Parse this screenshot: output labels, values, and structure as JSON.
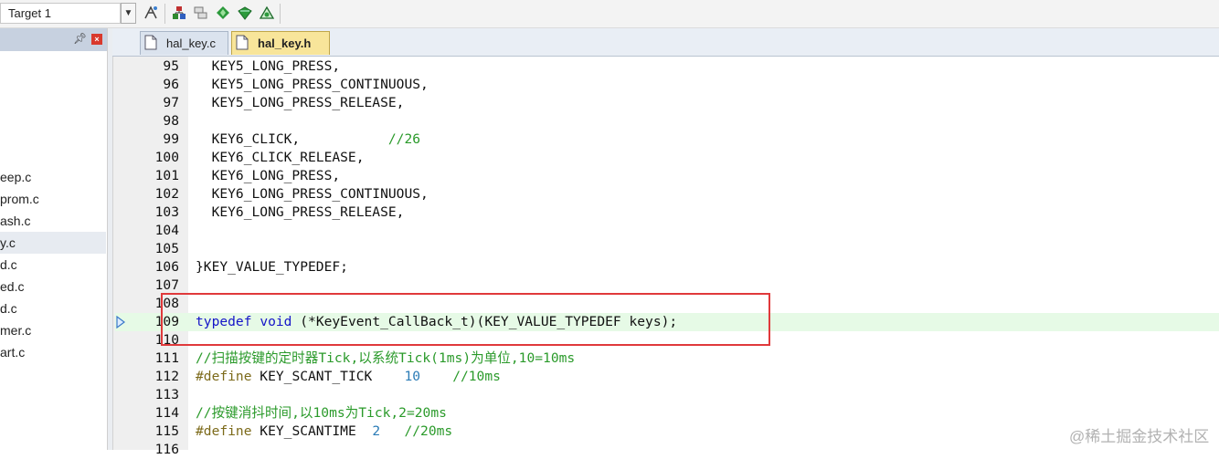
{
  "toolbar": {
    "target": "Target 1",
    "buttons": [
      "options-for-target-icon",
      "manage-project-icon",
      "file-extensions-icon",
      "select-packs-icon",
      "pack-installer-icon",
      "manage-runtime-icon"
    ]
  },
  "project_panel": {
    "files": [
      "eep.c",
      "prom.c",
      "ash.c",
      "y.c",
      "d.c",
      "ed.c",
      "d.c",
      "mer.c",
      "art.c"
    ],
    "selected_index": 3
  },
  "tabs": [
    {
      "label": "hal_key.c",
      "active": false
    },
    {
      "label": "hal_key.h",
      "active": true
    }
  ],
  "editor": {
    "lines": [
      {
        "num": "95",
        "tokens": [
          {
            "t": "  KEY5_LONG_PRESS,",
            "c": "plain"
          }
        ]
      },
      {
        "num": "96",
        "tokens": [
          {
            "t": "  KEY5_LONG_PRESS_CONTINUOUS,",
            "c": "plain"
          }
        ]
      },
      {
        "num": "97",
        "tokens": [
          {
            "t": "  KEY5_LONG_PRESS_RELEASE,",
            "c": "plain"
          }
        ]
      },
      {
        "num": "98",
        "tokens": []
      },
      {
        "num": "99",
        "tokens": [
          {
            "t": "  KEY6_CLICK,           ",
            "c": "plain"
          },
          {
            "t": "//26",
            "c": "comment"
          }
        ]
      },
      {
        "num": "100",
        "tokens": [
          {
            "t": "  KEY6_CLICK_RELEASE,",
            "c": "plain"
          }
        ]
      },
      {
        "num": "101",
        "tokens": [
          {
            "t": "  KEY6_LONG_PRESS,",
            "c": "plain"
          }
        ]
      },
      {
        "num": "102",
        "tokens": [
          {
            "t": "  KEY6_LONG_PRESS_CONTINUOUS,",
            "c": "plain"
          }
        ]
      },
      {
        "num": "103",
        "tokens": [
          {
            "t": "  KEY6_LONG_PRESS_RELEASE,",
            "c": "plain"
          }
        ]
      },
      {
        "num": "104",
        "tokens": []
      },
      {
        "num": "105",
        "tokens": []
      },
      {
        "num": "106",
        "tokens": [
          {
            "t": "}KEY_VALUE_TYPEDEF;",
            "c": "plain"
          }
        ]
      },
      {
        "num": "107",
        "tokens": []
      },
      {
        "num": "108",
        "tokens": []
      },
      {
        "num": "109",
        "tokens": [
          {
            "t": "typedef",
            "c": "keyword"
          },
          {
            "t": " ",
            "c": "plain"
          },
          {
            "t": "void",
            "c": "keyword"
          },
          {
            "t": " (*KeyEvent_CallBack_t)(KEY_VALUE_TYPEDEF keys);",
            "c": "plain"
          }
        ]
      },
      {
        "num": "110",
        "tokens": []
      },
      {
        "num": "111",
        "tokens": [
          {
            "t": "//扫描按键的定时器Tick,以系统Tick(1ms)为单位,10=10ms",
            "c": "comment"
          }
        ]
      },
      {
        "num": "112",
        "tokens": [
          {
            "t": "#define",
            "c": "preproc"
          },
          {
            "t": " KEY_SCANT_TICK    ",
            "c": "plain"
          },
          {
            "t": "10",
            "c": "number"
          },
          {
            "t": "    ",
            "c": "plain"
          },
          {
            "t": "//10ms",
            "c": "comment"
          }
        ]
      },
      {
        "num": "113",
        "tokens": []
      },
      {
        "num": "114",
        "tokens": [
          {
            "t": "//按键消抖时间,以10ms为Tick,2=20ms",
            "c": "comment"
          }
        ]
      },
      {
        "num": "115",
        "tokens": [
          {
            "t": "#define",
            "c": "preproc"
          },
          {
            "t": " KEY_SCANTIME  ",
            "c": "plain"
          },
          {
            "t": "2",
            "c": "number"
          },
          {
            "t": "   ",
            "c": "plain"
          },
          {
            "t": "//20ms",
            "c": "comment"
          }
        ]
      },
      {
        "num": "116",
        "tokens": []
      }
    ],
    "highlighted_line": "109"
  },
  "watermark": "@稀土掘金技术社区"
}
